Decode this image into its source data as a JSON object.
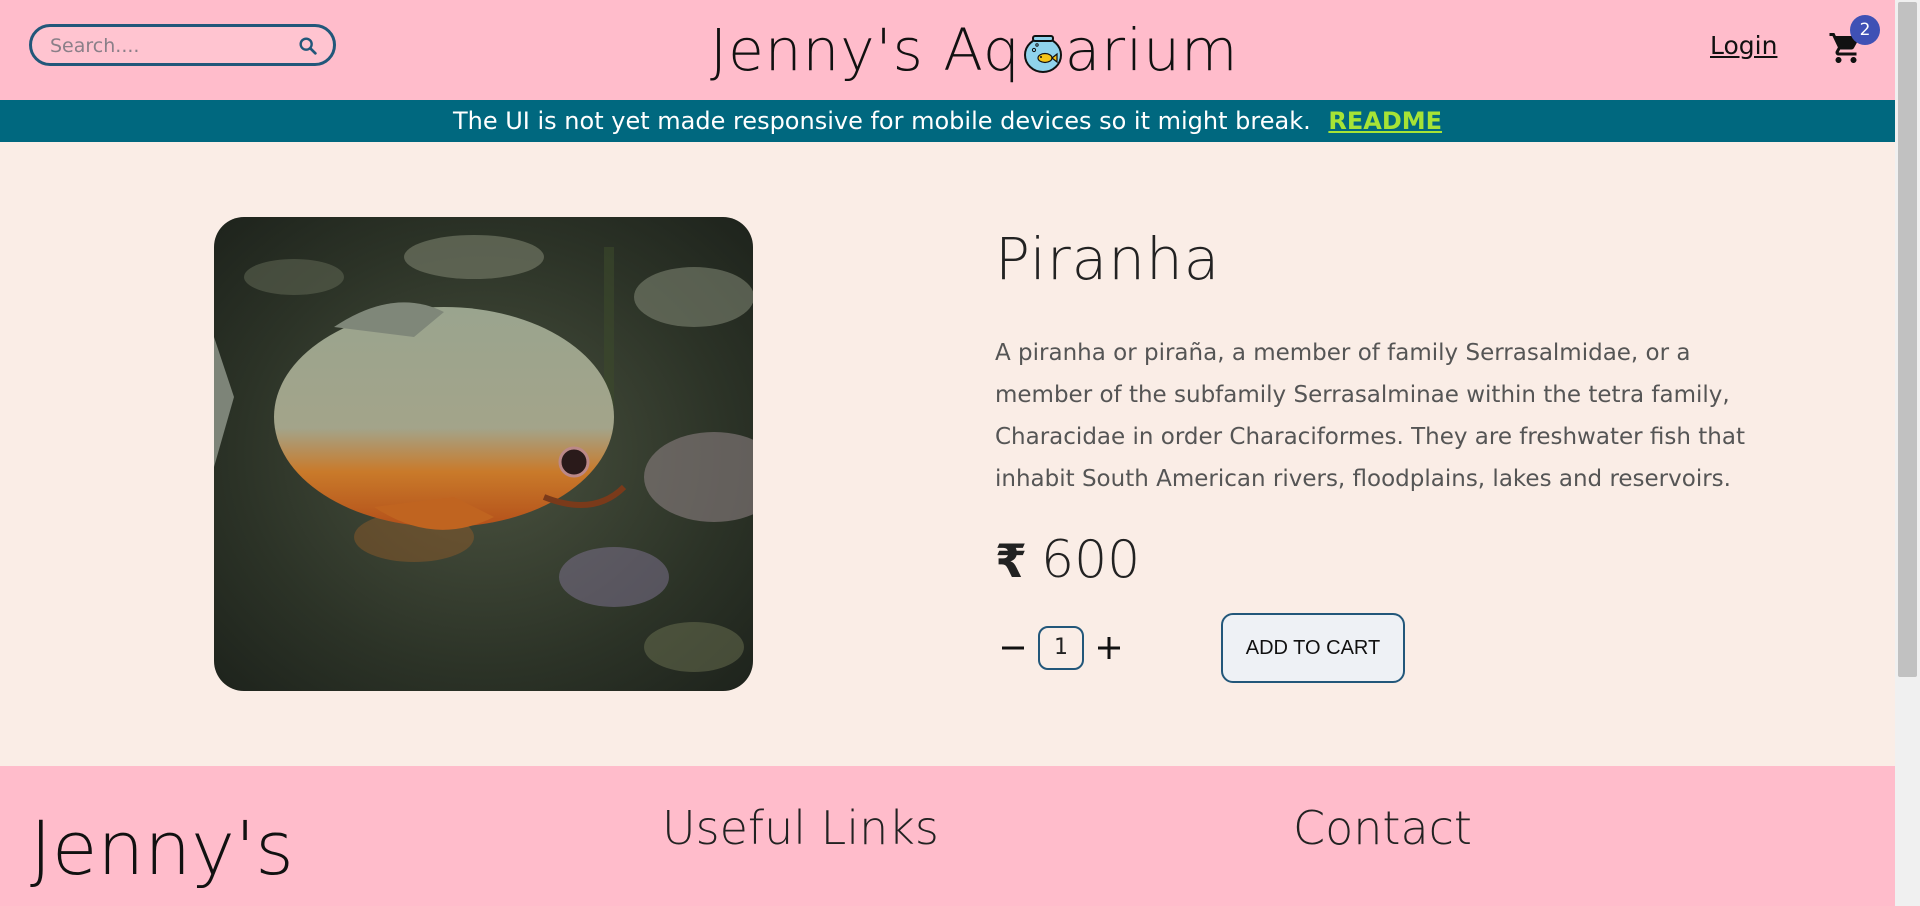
{
  "header": {
    "search_placeholder": "Search....",
    "brand_left": "Jenny's Aq",
    "brand_right": "arium",
    "login_label": "Login",
    "cart_count": "2"
  },
  "notice": {
    "text": "The UI is not yet made responsive for mobile devices so it might break.",
    "readme_label": "README"
  },
  "product": {
    "name": "Piranha",
    "description": "A piranha or piraña, a member of family Serrasalmidae, or a member of the subfamily Serrasalminae within the tetra family, Characidae in order Characiformes. They are freshwater fish that inhabit South American rivers, floodplains, lakes and reservoirs.",
    "currency_symbol": "₹",
    "price": "600",
    "quantity": "1",
    "add_to_cart_label": "ADD TO CART"
  },
  "footer": {
    "brand": "Jenny's",
    "useful_links_heading": "Useful Links",
    "contact_heading": "Contact"
  },
  "colors": {
    "header_bg": "#ffbccb",
    "notice_bg": "#00687f",
    "readme": "#a6e336",
    "page_bg": "#faede6",
    "badge": "#3f51b5",
    "border_accent": "#22577a"
  }
}
